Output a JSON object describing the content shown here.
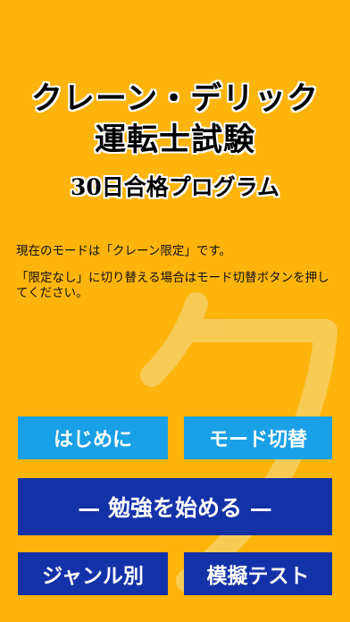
{
  "header": {
    "title_line1": "クレーン・デリック",
    "title_line2": "運転士試験",
    "subtitle": "30日合格プログラム"
  },
  "info": {
    "mode_text": "現在のモードは「クレーン限定」です。",
    "switch_text": "「限定なし」に切り替える場合はモード切替ボタンを押してください。"
  },
  "buttons": {
    "intro": "はじめに",
    "mode_switch": "モード切替",
    "start": "— 勉強を始める —",
    "by_genre": "ジャンル別",
    "mock_test": "模擬テスト"
  },
  "watermark": {
    "glyph": "ク"
  },
  "colors": {
    "background": "#fdb40c",
    "button_light": "#1aa0e6",
    "button_dark": "#1432a8",
    "watermark": "#f6cf62"
  }
}
